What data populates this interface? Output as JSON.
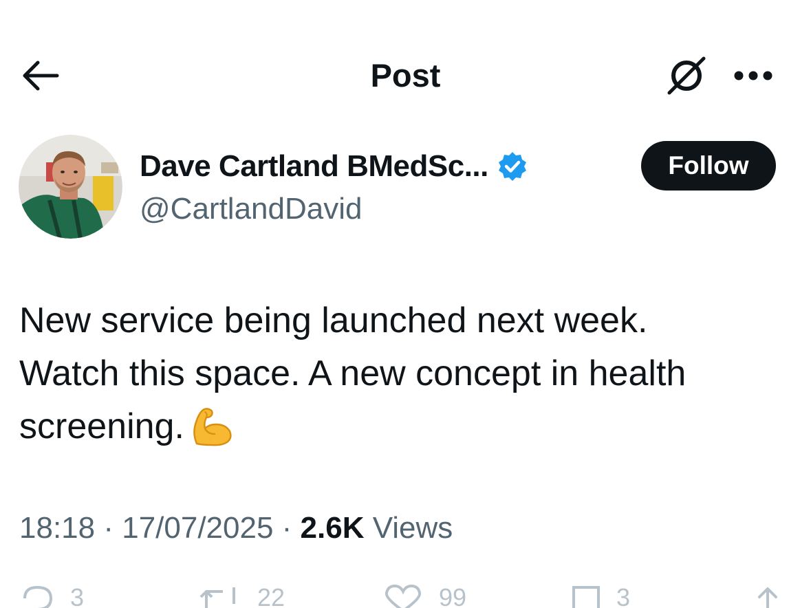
{
  "header": {
    "title": "Post"
  },
  "author": {
    "name": "Dave Cartland BMedSc...",
    "handle": "@CartlandDavid",
    "verified_color": "#1d9bf0",
    "follow_label": "Follow"
  },
  "tweet": {
    "line1": "New service being launched next week.",
    "line2": "Watch this space. A new concept in health",
    "line3": "screening.",
    "emoji": "flexed-biceps"
  },
  "meta": {
    "time": "18:18",
    "separator1": " · ",
    "date": "17/07/2025",
    "separator2": " · ",
    "views_count": "2.6K",
    "views_label": " Views"
  },
  "actions": {
    "replies": "3",
    "reposts": "22",
    "likes": "99",
    "bookmarks": "3"
  },
  "colors": {
    "text": "#0f1419",
    "secondary": "#536471",
    "accent": "#1d9bf0",
    "button_bg": "#0f1419"
  }
}
